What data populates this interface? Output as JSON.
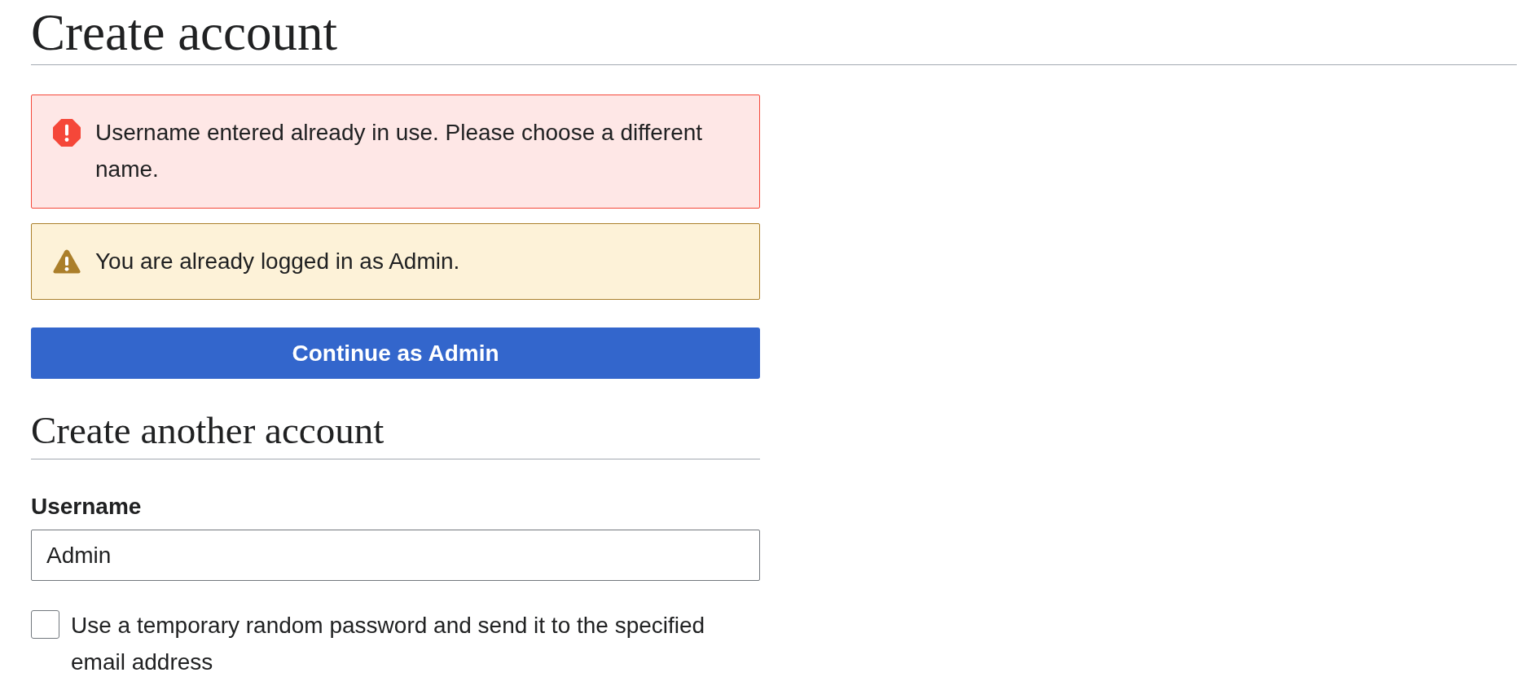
{
  "page_title": "Create account",
  "messages": [
    {
      "kind": "error",
      "text": "Username entered already in use. Please choose a different name."
    },
    {
      "kind": "warning",
      "text": "You are already logged in as Admin."
    }
  ],
  "continue_button": {
    "label": "Continue as Admin"
  },
  "section": {
    "title": "Create another account",
    "fields": [
      {
        "kind": "text",
        "label": "Username",
        "value": "Admin"
      },
      {
        "kind": "checkbox",
        "label": "Use a temporary random password and send it to the specified email address",
        "checked": false
      }
    ]
  }
}
